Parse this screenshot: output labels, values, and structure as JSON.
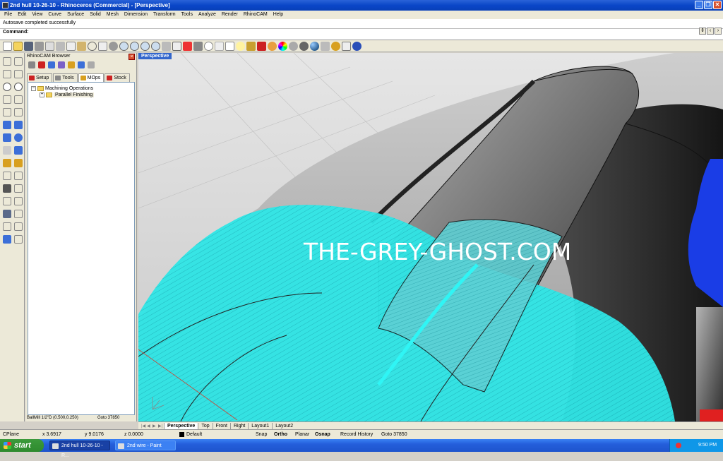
{
  "window": {
    "title": "2nd hull 10-26-10 - Rhinoceros (Commercial) - [Perspective]",
    "buttons": [
      "_",
      "❐",
      "✕"
    ]
  },
  "menu": [
    "File",
    "Edit",
    "View",
    "Curve",
    "Surface",
    "Solid",
    "Mesh",
    "Dimension",
    "Transform",
    "Tools",
    "Analyze",
    "Render",
    "RhinoCAM",
    "Help"
  ],
  "command": {
    "history": "Autosave completed successfully",
    "prompt": "Command:"
  },
  "browser": {
    "title": "RhinoCAM Browser",
    "close": "×",
    "tabs": [
      "Setup",
      "Tools",
      "MOps",
      "Stock"
    ],
    "active_tab": "MOps",
    "tree": {
      "root": "Machining Operations",
      "child": "Parallel Finishing"
    },
    "status": {
      "tool": "BallMill 1/2\"D  (0.500,0.250)",
      "goto": "Goto 37850"
    }
  },
  "viewport": {
    "label": "Perspective",
    "watermark": "THE-GREY-GHOST.COM"
  },
  "view_tabs": [
    "Perspective",
    "Top",
    "Front",
    "Right",
    "Layout1",
    "Layout2"
  ],
  "active_view_tab": "Perspective",
  "status": {
    "cplane": "CPlane",
    "x": "x 3.6917",
    "y": "y 9.0176",
    "z": "z 0.0000",
    "layer": "Default",
    "snap": "Snap",
    "ortho": "Ortho",
    "planar": "Planar",
    "osnap": "Osnap",
    "record": "Record History",
    "goto": "Goto 37850"
  },
  "taskbar": {
    "start": "start",
    "tasks": [
      "2nd hull 10-26-10 - R...",
      "2nd wire - Paint"
    ],
    "clock": "9:50 PM"
  },
  "colors": {
    "toolpath": "#2fe6e6",
    "tool_blue": "#1a3de6",
    "title_blue": "#0a46c8"
  }
}
